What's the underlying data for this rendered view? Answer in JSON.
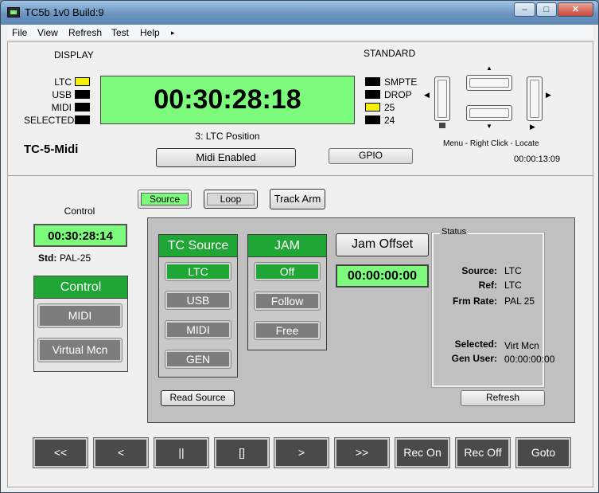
{
  "window": {
    "title": "TC5b 1v0 Build:9",
    "min": "–",
    "max": "□",
    "close": "✕"
  },
  "menu": [
    "File",
    "View",
    "Refresh",
    "Test",
    "Help",
    "▸"
  ],
  "display": {
    "heading": "DISPLAY",
    "indicators": [
      {
        "label": "LTC",
        "on": true
      },
      {
        "label": "USB",
        "on": false
      },
      {
        "label": "MIDI",
        "on": false
      },
      {
        "label": "SELECTED",
        "on": false
      }
    ],
    "timecode": "00:30:28:18",
    "position_caption": "3: LTC Position",
    "device_name": "TC-5-Midi",
    "midi_button": "Midi Enabled"
  },
  "standard": {
    "heading": "STANDARD",
    "indicators": [
      {
        "label": "SMPTE",
        "on": false
      },
      {
        "label": "DROP",
        "on": false
      },
      {
        "label": "25",
        "on": true
      },
      {
        "label": "24",
        "on": false
      }
    ],
    "gpio_button": "GPIO"
  },
  "locate": {
    "caption": "Menu - Right Click - Locate",
    "time": "00:00:13:09"
  },
  "mode_tabs": [
    {
      "label": "Source",
      "active": true
    },
    {
      "label": "Loop",
      "active": false
    },
    {
      "label": "Track Arm",
      "active": false
    }
  ],
  "control_left": {
    "heading": "Control",
    "timecode": "00:30:28:14",
    "std_label": "Std:",
    "std_value": "PAL-25",
    "panel_title": "Control",
    "buttons": [
      "MIDI",
      "Virtual Mcn"
    ]
  },
  "tc_source": {
    "title": "TC Source",
    "buttons": [
      {
        "label": "LTC",
        "active": true
      },
      {
        "label": "USB",
        "active": false
      },
      {
        "label": "MIDI",
        "active": false
      },
      {
        "label": "GEN",
        "active": false
      }
    ],
    "read_button": "Read Source"
  },
  "jam": {
    "title": "JAM",
    "buttons": [
      {
        "label": "Off",
        "active": true
      },
      {
        "label": "Follow",
        "active": false
      },
      {
        "label": "Free",
        "active": false
      }
    ]
  },
  "jam_offset": {
    "label": "Jam Offset",
    "value": "00:00:00:00"
  },
  "status": {
    "legend": "Status",
    "rows": [
      {
        "key": "Source:",
        "value": "LTC"
      },
      {
        "key": "Ref:",
        "value": "LTC"
      },
      {
        "key": "Frm Rate:",
        "value": "PAL 25"
      },
      {
        "key": "Selected:",
        "value": "Virt Mcn"
      },
      {
        "key": "Gen User:",
        "value": "00:00:00:00"
      }
    ],
    "refresh_button": "Refresh"
  },
  "transport": [
    "<<",
    "<",
    "||",
    "[]",
    ">",
    ">>",
    "Rec On",
    "Rec Off",
    "Goto"
  ],
  "colors": {
    "green_active": "#1fa635",
    "timecode_bg": "#7dfb7d",
    "indicator_on": "#f4f000"
  },
  "icons": [
    "locate-up-arrow",
    "locate-down-arrow",
    "locate-left-arrow",
    "locate-right-arrow"
  ]
}
